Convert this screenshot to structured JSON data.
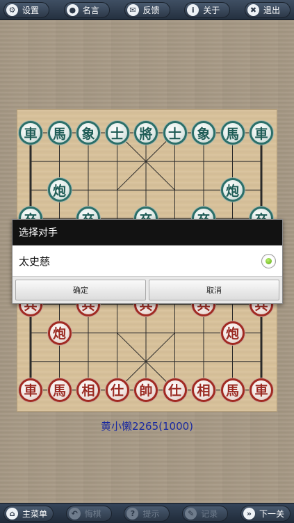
{
  "topbar": [
    {
      "id": "settings",
      "icon": "gear-icon",
      "glyph": "⚙",
      "label": "设置"
    },
    {
      "id": "quotes",
      "icon": "speech-bubble-icon",
      "glyph": "●",
      "label": "名言"
    },
    {
      "id": "feedback",
      "icon": "mail-icon",
      "glyph": "✉",
      "label": "反馈"
    },
    {
      "id": "about",
      "icon": "info-icon",
      "glyph": "i",
      "label": "关于"
    },
    {
      "id": "exit",
      "icon": "close-icon",
      "glyph": "✖",
      "label": "退出"
    }
  ],
  "bottombar": [
    {
      "id": "main-menu",
      "icon": "home-icon",
      "glyph": "⌂",
      "label": "主菜单",
      "enabled": true
    },
    {
      "id": "undo",
      "icon": "undo-icon",
      "glyph": "↶",
      "label": "悔棋",
      "enabled": false
    },
    {
      "id": "hint",
      "icon": "hint-icon",
      "glyph": "?",
      "label": "提示",
      "enabled": false
    },
    {
      "id": "record",
      "icon": "pencil-icon",
      "glyph": "✎",
      "label": "记录",
      "enabled": false
    },
    {
      "id": "next",
      "icon": "next-icon",
      "glyph": "»",
      "label": "下一关",
      "enabled": true
    }
  ],
  "board": {
    "columns": 9,
    "rows": 10,
    "colors": {
      "green": "#2b6f69",
      "red": "#a12a22",
      "board": "#d9c29b"
    },
    "pieces": [
      {
        "side": "green",
        "char": "車",
        "col": 0,
        "row": 0
      },
      {
        "side": "green",
        "char": "馬",
        "col": 1,
        "row": 0
      },
      {
        "side": "green",
        "char": "象",
        "col": 2,
        "row": 0
      },
      {
        "side": "green",
        "char": "士",
        "col": 3,
        "row": 0
      },
      {
        "side": "green",
        "char": "將",
        "col": 4,
        "row": 0
      },
      {
        "side": "green",
        "char": "士",
        "col": 5,
        "row": 0
      },
      {
        "side": "green",
        "char": "象",
        "col": 6,
        "row": 0
      },
      {
        "side": "green",
        "char": "馬",
        "col": 7,
        "row": 0
      },
      {
        "side": "green",
        "char": "車",
        "col": 8,
        "row": 0
      },
      {
        "side": "green",
        "char": "炮",
        "col": 1,
        "row": 2
      },
      {
        "side": "green",
        "char": "炮",
        "col": 7,
        "row": 2
      },
      {
        "side": "green",
        "char": "卒",
        "col": 0,
        "row": 3
      },
      {
        "side": "green",
        "char": "卒",
        "col": 2,
        "row": 3
      },
      {
        "side": "green",
        "char": "卒",
        "col": 4,
        "row": 3
      },
      {
        "side": "green",
        "char": "卒",
        "col": 6,
        "row": 3
      },
      {
        "side": "green",
        "char": "卒",
        "col": 8,
        "row": 3
      },
      {
        "side": "red",
        "char": "兵",
        "col": 0,
        "row": 6
      },
      {
        "side": "red",
        "char": "兵",
        "col": 2,
        "row": 6
      },
      {
        "side": "red",
        "char": "兵",
        "col": 4,
        "row": 6
      },
      {
        "side": "red",
        "char": "兵",
        "col": 6,
        "row": 6
      },
      {
        "side": "red",
        "char": "兵",
        "col": 8,
        "row": 6
      },
      {
        "side": "red",
        "char": "炮",
        "col": 1,
        "row": 7
      },
      {
        "side": "red",
        "char": "炮",
        "col": 7,
        "row": 7
      },
      {
        "side": "red",
        "char": "車",
        "col": 0,
        "row": 9
      },
      {
        "side": "red",
        "char": "馬",
        "col": 1,
        "row": 9
      },
      {
        "side": "red",
        "char": "相",
        "col": 2,
        "row": 9
      },
      {
        "side": "red",
        "char": "仕",
        "col": 3,
        "row": 9
      },
      {
        "side": "red",
        "char": "帥",
        "col": 4,
        "row": 9
      },
      {
        "side": "red",
        "char": "仕",
        "col": 5,
        "row": 9
      },
      {
        "side": "red",
        "char": "相",
        "col": 6,
        "row": 9
      },
      {
        "side": "red",
        "char": "馬",
        "col": 7,
        "row": 9
      },
      {
        "side": "red",
        "char": "車",
        "col": 8,
        "row": 9
      }
    ]
  },
  "player": {
    "name": "黄小懒2265(1000)",
    "color": "#1a2aa0"
  },
  "dialog": {
    "title": "选择对手",
    "option": {
      "label": "太史慈",
      "selected": true
    },
    "confirm_label": "确定",
    "cancel_label": "取消"
  }
}
